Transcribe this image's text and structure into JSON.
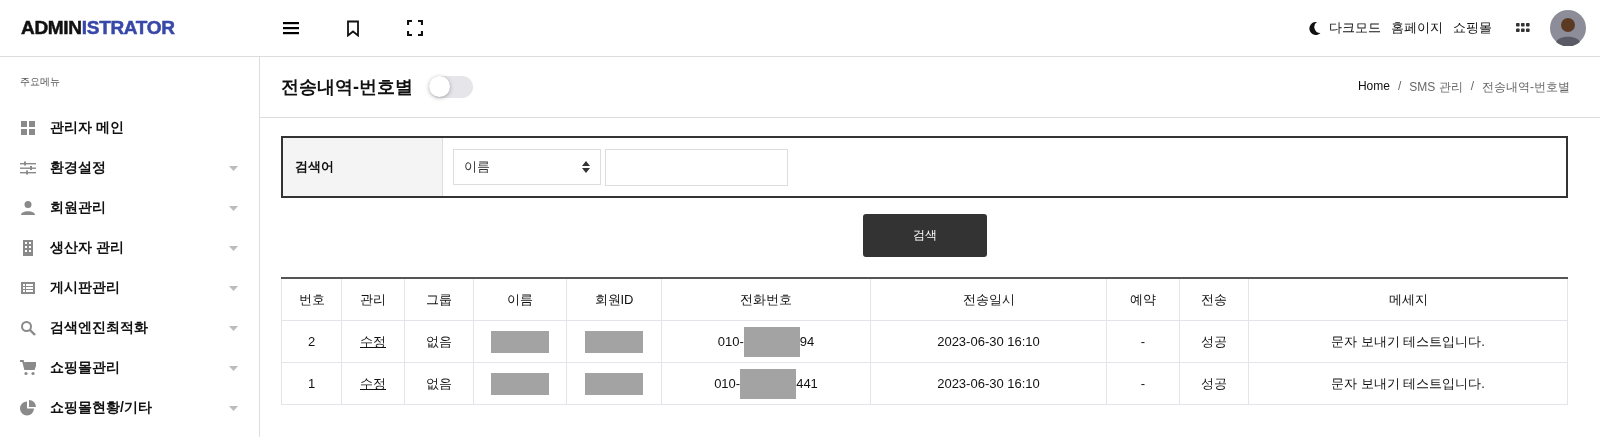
{
  "header": {
    "logo": {
      "dark": "ADMIN",
      "accent": "ISTRATOR"
    },
    "links": [
      {
        "kind": "dark-mode",
        "label": "다크모드"
      },
      {
        "kind": "link",
        "label": "홈페이지"
      },
      {
        "kind": "link",
        "label": "쇼핑몰"
      }
    ]
  },
  "sidebar": {
    "heading": "주요메뉴",
    "items": [
      {
        "label": "관리자 메인",
        "expandable": false
      },
      {
        "label": "환경설정",
        "expandable": true
      },
      {
        "label": "회원관리",
        "expandable": true
      },
      {
        "label": "생산자 관리",
        "expandable": true
      },
      {
        "label": "게시판관리",
        "expandable": true
      },
      {
        "label": "검색엔진최적화",
        "expandable": true
      },
      {
        "label": "쇼핑몰관리",
        "expandable": true
      },
      {
        "label": "쇼핑몰현황/기타",
        "expandable": true
      }
    ]
  },
  "page": {
    "title": "전송내역-번호별",
    "toggle_on": false,
    "breadcrumb": [
      {
        "kind": "crumb",
        "text": "Home"
      },
      {
        "kind": "separator",
        "text": "/"
      },
      {
        "kind": "crumb",
        "text": "SMS 관리"
      },
      {
        "kind": "separator",
        "text": "/"
      },
      {
        "kind": "crumb",
        "text": "전송내역-번호별"
      }
    ]
  },
  "search": {
    "label": "검색어",
    "select_value": "이름",
    "button": "검색"
  },
  "table": {
    "columns": [
      "번호",
      "관리",
      "그룹",
      "이름",
      "회원ID",
      "전화번호",
      "전송일시",
      "예약",
      "전송",
      "메세지"
    ],
    "rows": [
      {
        "no": "2",
        "action": "수정",
        "group": "없음",
        "name_redacted": true,
        "id_redacted": true,
        "phone_start": "010-",
        "phone_end": "94",
        "sent_at": "2023-06-30 16:10",
        "reserved": "-",
        "status": "성공",
        "message": "문자 보내기 테스트입니다."
      },
      {
        "no": "1",
        "action": "수정",
        "group": "없음",
        "name_redacted": true,
        "id_redacted": true,
        "phone_start": "010-",
        "phone_end": "441",
        "sent_at": "2023-06-30 16:10",
        "reserved": "-",
        "status": "성공",
        "message": "문자 보내기 테스트입니다."
      }
    ]
  }
}
